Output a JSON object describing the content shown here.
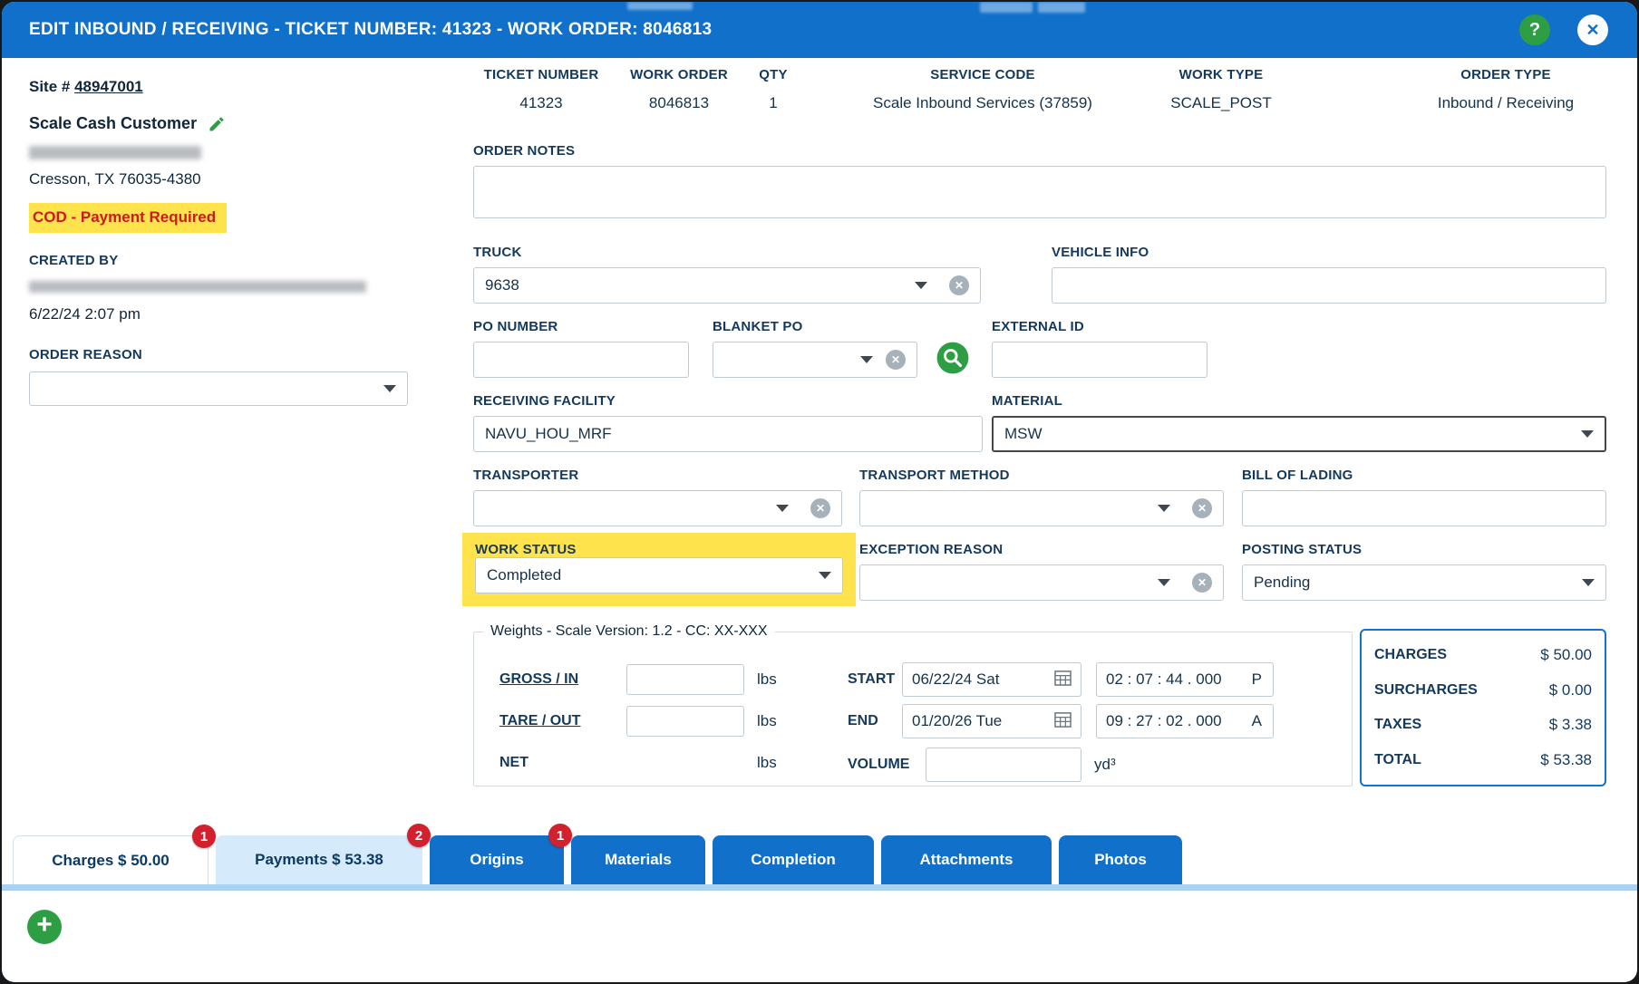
{
  "header": {
    "title": "EDIT INBOUND / RECEIVING - TICKET NUMBER: 41323 - WORK ORDER: 8046813",
    "help": "?",
    "close": "✕"
  },
  "icons": {
    "plus": "+",
    "clear": "✕"
  },
  "left_panel": {
    "site_label": "Site #",
    "site_number": "48947001",
    "customer_name": "Scale Cash Customer",
    "address_city": "Cresson, TX 76035-4380",
    "cod_notice": "COD - Payment Required",
    "created_by_label": "CREATED BY",
    "created_at": "6/22/24 2:07 pm",
    "order_reason_label": "ORDER REASON",
    "order_reason_value": ""
  },
  "summary": {
    "ticket_number": {
      "label": "TICKET NUMBER",
      "value": "41323"
    },
    "work_order": {
      "label": "WORK ORDER",
      "value": "8046813"
    },
    "qty": {
      "label": "QTY",
      "value": "1"
    },
    "service_code": {
      "label": "SERVICE CODE",
      "value": "Scale Inbound Services (37859)"
    },
    "work_type": {
      "label": "WORK TYPE",
      "value": "SCALE_POST"
    },
    "order_type": {
      "label": "ORDER TYPE",
      "value": "Inbound / Receiving"
    }
  },
  "form": {
    "order_notes": {
      "label": "ORDER NOTES",
      "value": ""
    },
    "truck": {
      "label": "TRUCK",
      "value": "9638"
    },
    "vehicle_info": {
      "label": "VEHICLE INFO",
      "value": ""
    },
    "po_number": {
      "label": "PO NUMBER",
      "value": ""
    },
    "blanket_po": {
      "label": "BLANKET PO",
      "value": ""
    },
    "external_id": {
      "label": "EXTERNAL ID",
      "value": ""
    },
    "receiving_facility": {
      "label": "RECEIVING FACILITY",
      "value": "NAVU_HOU_MRF"
    },
    "material": {
      "label": "MATERIAL",
      "value": "MSW"
    },
    "transporter": {
      "label": "TRANSPORTER",
      "value": ""
    },
    "transport_method": {
      "label": "TRANSPORT METHOD",
      "value": ""
    },
    "bill_of_lading": {
      "label": "BILL OF LADING",
      "value": ""
    },
    "work_status": {
      "label": "WORK STATUS",
      "value": "Completed"
    },
    "exception_reason": {
      "label": "EXCEPTION REASON",
      "value": ""
    },
    "posting_status": {
      "label": "POSTING STATUS",
      "value": "Pending"
    }
  },
  "weights": {
    "legend": "Weights - Scale Version: 1.2 - CC: XX-XXX",
    "gross": {
      "label": "GROSS / IN",
      "value": "",
      "unit": "lbs"
    },
    "tare": {
      "label": "TARE / OUT",
      "value": "",
      "unit": "lbs"
    },
    "net": {
      "label": "NET",
      "value": "",
      "unit": "lbs"
    },
    "start": {
      "label": "START",
      "date": "06/22/24 Sat",
      "time": "02 : 07 : 44 . 000",
      "meridiem": "P"
    },
    "end": {
      "label": "END",
      "date": "01/20/26 Tue",
      "time": "09 : 27 : 02 . 000",
      "meridiem": "A"
    },
    "volume": {
      "label": "VOLUME",
      "value": "",
      "unit": "yd³"
    }
  },
  "totals": {
    "rows": [
      {
        "label": "CHARGES",
        "value": "$ 50.00"
      },
      {
        "label": "SURCHARGES",
        "value": "$ 0.00"
      },
      {
        "label": "TAXES",
        "value": "$ 3.38"
      },
      {
        "label": "TOTAL",
        "value": "$ 53.38"
      }
    ]
  },
  "tabs": [
    {
      "label": "Charges $ 50.00",
      "badge": "1"
    },
    {
      "label": "Payments $ 53.38",
      "badge": "2"
    },
    {
      "label": "Origins",
      "badge": "1"
    },
    {
      "label": "Materials"
    },
    {
      "label": "Completion"
    },
    {
      "label": "Attachments"
    },
    {
      "label": "Photos"
    }
  ]
}
